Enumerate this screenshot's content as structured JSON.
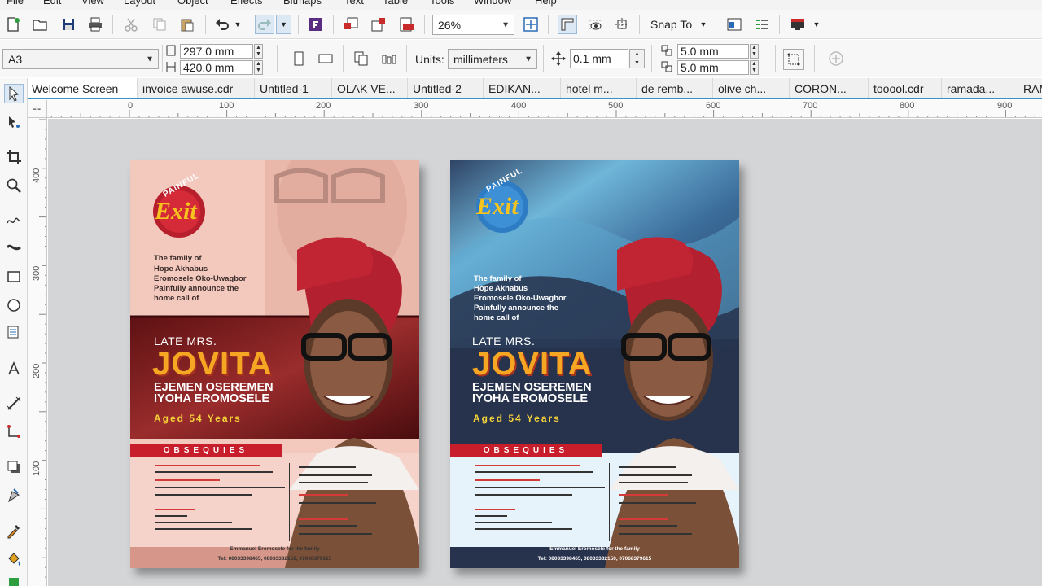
{
  "menu": [
    "File",
    "Edit",
    "View",
    "Layout",
    "Object",
    "Effects",
    "Bitmaps",
    "Text",
    "Table",
    "Tools",
    "Window",
    "Help"
  ],
  "toolbar": {
    "zoom": "26%",
    "snap_to": "Snap To"
  },
  "propbar": {
    "page_size": "A3",
    "width": "297.0 mm",
    "height": "420.0 mm",
    "units_label": "Units:",
    "units_value": "millimeters",
    "nudge": "0.1 mm",
    "dup_x": "5.0 mm",
    "dup_y": "5.0 mm"
  },
  "tabs": [
    "Welcome Screen",
    "invoice awuse.cdr",
    "Untitled-1",
    "OLAK VE...",
    "Untitled-2",
    "EDIKAN...",
    "hotel m...",
    "de remb...",
    "olive ch...",
    "CORON...",
    "tooool.cdr",
    "ramada...",
    "RAM"
  ],
  "ruler": {
    "h_marks": [
      "0",
      "100",
      "200",
      "300",
      "400",
      "500",
      "600",
      "700",
      "800",
      "900"
    ],
    "v_marks": [
      "400",
      "300",
      "200",
      "100"
    ]
  },
  "flyers": [
    {
      "logo_top": "PAINFUL",
      "logo_main": "Exit",
      "family_lines": [
        "The family of",
        "Hope Akhabus",
        "Eromosele Oko-Uwagbor",
        "Painfully announce the",
        "home call of"
      ],
      "late": "LATE MRS.",
      "first_name": "JOVITA",
      "names": [
        "EJEMEN OSEREMEN",
        "IYOHA EROMOSELE"
      ],
      "aged": "Aged 54 Years",
      "obsequies": "OBSEQUIES",
      "footer_line1": "Emmanuel Eromosele for the family",
      "footer_line2": "Tel: 08033398465, 08033332150, 07068379615"
    },
    {
      "logo_top": "PAINFUL",
      "logo_main": "Exit",
      "family_lines": [
        "The family of",
        "Hope Akhabus",
        "Eromosele Oko-Uwagbor",
        "Painfully announce the",
        "home call of"
      ],
      "late": "LATE MRS.",
      "first_name": "JOVITA",
      "names": [
        "EJEMEN OSEREMEN",
        "IYOHA EROMOSELE"
      ],
      "aged": "Aged 54 Years",
      "obsequies": "OBSEQUIES",
      "footer_line1": "Emmanuel Eromosele for the family",
      "footer_line2": "Tel: 08033398465, 08033332150, 07068379615"
    }
  ],
  "colors": {
    "accent": "#3c8fc4",
    "flyer1_bg": "#f3c9bd",
    "flyer2_bg": "#27324c",
    "banner_red": "#c81e2c",
    "gold": "#f5d33a"
  }
}
